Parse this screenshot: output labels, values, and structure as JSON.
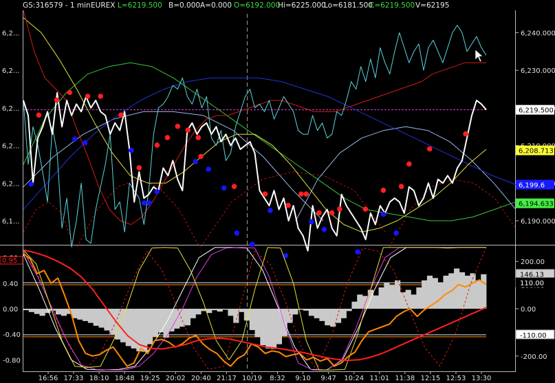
{
  "header": {
    "symbol": "GS:316579 - 1 min",
    "exchange": "EUREX",
    "last": "L=6219.500",
    "bid": "B=0.000",
    "ask": "A=0.000",
    "open": "O=6192.000",
    "high": "Hi=6225.000",
    "low": "Lo=6181.500",
    "close": "C=6219.500",
    "volume": "V=62195"
  },
  "colors": {
    "background": "#000000",
    "axis": "#cfcfcf",
    "price": "#ffffff",
    "cyan": "#59d6dc",
    "red": "#d41c14",
    "green": "#3cc43c",
    "blue": "#2035d8",
    "lightblue": "#9ab8e8",
    "yellow": "#e6e23a",
    "orange": "#ff8a00",
    "magenta": "#e040e0",
    "gray_fill": "#c9c9c9",
    "dot_red": "#ff2020",
    "dot_blue": "#1414ff"
  },
  "chart_data": [
    {
      "type": "line",
      "panel": "price",
      "ylim": [
        6183.6,
        6245.4
      ],
      "y_ticks": [
        6190.0,
        6200.0,
        6210.0,
        6220.0,
        6230.0,
        6240.0
      ],
      "y_tick_labels": [
        "6,190.000",
        "6,200.000",
        "6,210.000",
        "6,220.000",
        "6,230.000",
        "6,240.000"
      ],
      "left_tick_labels": [
        "6,2...",
        "6,2...",
        "6,2...",
        "6,2...",
        "6,2...",
        "6,1..."
      ],
      "left_tick_values": [
        6240,
        6230,
        6220,
        6210,
        6200,
        6190
      ],
      "price_labels": [
        {
          "text": "6,219.500",
          "value": 6219.5,
          "bg": "#ffffff",
          "fg": "#000000"
        },
        {
          "text": "6,208.713",
          "value": 6208.713,
          "bg": "#ffff33",
          "fg": "#000000"
        },
        {
          "text": "6,199.6",
          "value": 6199.6,
          "bg": "#1a1aff",
          "fg": "#ffffff"
        },
        {
          "text": "6,194.633",
          "value": 6194.633,
          "bg": "#44ee44",
          "fg": "#000000"
        }
      ],
      "reference_line": 6219.5,
      "x_ticks": [
        "16:56",
        "17:33",
        "18:10",
        "18:48",
        "19:25",
        "20:02",
        "20:40",
        "21:17",
        "10/19",
        "8:32",
        "9:10",
        "9:47",
        "10:24",
        "11:01",
        "11:38",
        "12:15",
        "12:53",
        "13:30"
      ],
      "series": [
        {
          "role": "price",
          "color": "#ffffff",
          "values": [
            6222,
            6218,
            6200,
            6212,
            6215,
            6219,
            6213,
            6224,
            6215,
            6222,
            6218,
            6221,
            6219,
            6223,
            6220,
            6222,
            6219,
            6218,
            6213,
            6216,
            6214,
            6219,
            6209,
            6195,
            6203,
            6196,
            6197,
            6199,
            6198,
            6204,
            6202,
            6206,
            6201,
            6198,
            6214,
            6216,
            6213,
            6215,
            6216,
            6213,
            6215,
            6211,
            6213,
            6210,
            6212,
            6209,
            6210,
            6211,
            6208,
            6198,
            6196,
            6194,
            6198,
            6193,
            6196,
            6190,
            6194,
            6188,
            6186,
            6182,
            6194,
            6188,
            6191,
            6193,
            6188,
            6186,
            6197,
            6194,
            6192,
            6190,
            6188,
            6185,
            6192,
            6189,
            6194,
            6192,
            6195,
            6196,
            6195,
            6192,
            6199,
            6198,
            6194,
            6196,
            6200,
            6196,
            6201,
            6200,
            6202,
            6200,
            6204,
            6206,
            6212,
            6218,
            6222,
            6221,
            6219.5
          ]
        },
        {
          "role": "cyan overlay",
          "color": "#59d6dc",
          "values": [
            6222,
            6205,
            6215,
            6210,
            6203,
            6195,
            6215,
            6208,
            6188,
            6196,
            6183,
            6190,
            6200,
            6185,
            6184,
            6193,
            6199,
            6205,
            6213,
            6193,
            6195,
            6187,
            6200,
            6198,
            6196,
            6189,
            6198,
            6213,
            6220,
            6221,
            6223,
            6226,
            6225,
            6228,
            6223,
            6221,
            6225,
            6220,
            6223,
            6212,
            6210,
            6214,
            6206,
            6208,
            6215,
            6219,
            6223,
            6225,
            6220,
            6221,
            6219,
            6222,
            6217,
            6220,
            6223,
            6221,
            6219,
            6214,
            6213,
            6213,
            6218,
            6214,
            6216,
            6212,
            6213,
            6219,
            6218,
            6222,
            6227,
            6225,
            6231,
            6227,
            6233,
            6228,
            6236,
            6232,
            6229,
            6235,
            6240,
            6236,
            6232,
            6235,
            6237,
            6230,
            6236,
            6238,
            6235,
            6232,
            6236,
            6240,
            6242,
            6240,
            6235,
            6237,
            6239,
            6236,
            6234
          ]
        },
        {
          "role": "red curve",
          "color": "#d41c14",
          "values": [
            6246,
            6235,
            6228,
            6225,
            6222,
            6214,
            6207,
            6199,
            6193,
            6190,
            6189,
            6191,
            6195,
            6200,
            6205,
            6210,
            6214,
            6217,
            6218,
            6218,
            6219,
            6220,
            6221,
            6222,
            6222,
            6221,
            6220,
            6219,
            6219,
            6219,
            6220,
            6221,
            6222,
            6223,
            6224,
            6225,
            6226,
            6227,
            6229,
            6230,
            6231,
            6232,
            6232,
            6232
          ]
        },
        {
          "role": "green curve",
          "color": "#3cc43c",
          "values": [
            6205,
            6217,
            6224,
            6229,
            6231,
            6232,
            6231,
            6228,
            6224,
            6220,
            6216,
            6212,
            6208,
            6204,
            6200,
            6196,
            6193,
            6192,
            6191,
            6190,
            6190,
            6191,
            6193,
            6195
          ]
        },
        {
          "role": "blue curve",
          "color": "#2035d8",
          "values": [
            6193,
            6200,
            6207,
            6213,
            6218,
            6222,
            6225,
            6227,
            6228,
            6228,
            6228,
            6227,
            6225,
            6223,
            6220,
            6217,
            6214,
            6211,
            6208,
            6205,
            6202,
            6199.6
          ]
        },
        {
          "role": "light blue arc 1",
          "color": "#9ab8e8",
          "values": [
            6199,
            6207,
            6213,
            6217,
            6219,
            6219,
            6218,
            6214,
            6207,
            6198,
            6190
          ]
        },
        {
          "role": "light blue arc 2",
          "color": "#9ab8e8",
          "values": [
            6190,
            6201,
            6208,
            6212,
            6214,
            6215,
            6214,
            6211,
            6206,
            6200,
            6193
          ]
        },
        {
          "role": "yellow curve",
          "color": "#e6e23a",
          "values": [
            6244,
            6240,
            6233,
            6225,
            6216,
            6208,
            6202,
            6200,
            6200,
            6203,
            6207,
            6211,
            6213,
            6213,
            6210,
            6205,
            6199,
            6193,
            6189,
            6187,
            6188,
            6190,
            6193,
            6196,
            6200,
            6205,
            6209
          ]
        },
        {
          "role": "dashed red arcs",
          "color": "#b81410",
          "style": "dashed",
          "segments": [
            [
              6187,
              6193,
              6195,
              6192,
              6183
            ],
            [
              6183,
              6193,
              6199,
              6201,
              6199,
              6193,
              6183
            ],
            [
              6183,
              6195,
              6201,
              6203,
              6202,
              6198,
              6187
            ],
            [
              6183,
              6193,
              6199,
              6201,
              6200,
              6196,
              6188
            ]
          ]
        },
        {
          "role": "red markers (highs)",
          "color": "#ff2020",
          "marker": "dot",
          "x": [
            0.06,
            0.13,
            0.18,
            0.25,
            0.3,
            0.38,
            0.45,
            0.52,
            0.56,
            0.6,
            0.64,
            0.68,
            0.69,
            0.82,
            0.94,
            1.03,
            1.08,
            1.1,
            1.15,
            1.2,
            1.23,
            1.33,
            1.4,
            1.47,
            1.5,
            1.58,
            1.72
          ],
          "values": [
            6217,
            6221,
            6223,
            6222,
            6222,
            6217,
            6203,
            6209,
            6211,
            6214,
            6213,
            6211,
            6206,
            6198,
            6196,
            6193,
            6196,
            6196,
            6191,
            6191,
            6192,
            6192,
            6197,
            6198,
            6204,
            6208,
            6212
          ]
        },
        {
          "role": "blue markers (lows)",
          "color": "#1414ff",
          "marker": "dot",
          "x": [
            0.03,
            0.2,
            0.24,
            0.42,
            0.47,
            0.49,
            0.52,
            0.67,
            0.72,
            0.78,
            0.83,
            0.89,
            0.96,
            1.02,
            1.12,
            1.17,
            1.3,
            1.4,
            1.45
          ],
          "values": [
            6201,
            6213,
            6212,
            6210,
            6196,
            6196,
            6199,
            6207,
            6205,
            6200,
            6188,
            6185,
            6194,
            6182,
            6191,
            6189,
            6183,
            6193,
            6188
          ]
        }
      ]
    },
    {
      "type": "area",
      "panel": "indicator",
      "ylim": [
        -0.98,
        0.98
      ],
      "left_ticks": [
        0.8,
        0.4,
        0.0,
        -0.4,
        -0.8
      ],
      "left_tick_labels": [
        "0.80",
        "0.40",
        "0.00",
        "-0.40",
        "-0.80"
      ],
      "left_marker": "0.95",
      "right_ticks": [
        200,
        100,
        0,
        -100,
        -200
      ],
      "right_tick_labels": [
        "200.00",
        "100.00",
        "0.00",
        "-100.00",
        "-200.00"
      ],
      "right_labels": [
        {
          "text": "146.13",
          "value": 146.13,
          "bg": "#cfcfcf",
          "fg": "#000000"
        },
        {
          "text": "110.00",
          "value": 110,
          "bg": "#000000",
          "fg": "#ffffff"
        },
        {
          "text": "-110.00",
          "value": -110,
          "bg": "#ffffff",
          "fg": "#000000"
        }
      ],
      "hlines_right_units": [
        110,
        -110
      ],
      "series": [
        {
          "role": "gray histogram",
          "color": "#c9c9c9",
          "values": [
            -6,
            -14,
            -22,
            -30,
            -18,
            -8,
            -24,
            -30,
            -22,
            -40,
            -46,
            -52,
            -60,
            -72,
            -80,
            -92,
            -108,
            -130,
            -142,
            -158,
            -168,
            -180,
            -182,
            -150,
            -118,
            -100,
            -122,
            -96,
            -84,
            -76,
            -70,
            -40,
            -24,
            -10,
            -18,
            -6,
            -12,
            -4,
            -30,
            -60,
            -14,
            -50,
            -90,
            -120,
            -154,
            -168,
            -170,
            -150,
            -116,
            -60,
            -24,
            -4,
            -8,
            -30,
            -40,
            -52,
            -70,
            -76,
            -60,
            -40,
            -10,
            30,
            60,
            54,
            80,
            56,
            90,
            110,
            100,
            120,
            70,
            80,
            60,
            90,
            120,
            140,
            130,
            110,
            140,
            150,
            170,
            154,
            140,
            150,
            120,
            146
          ]
        },
        {
          "role": "orange oscillator",
          "color": "#ff8a00",
          "values": [
            0.86,
            0.78,
            0.55,
            0.6,
            0.4,
            0.48,
            0.2,
            -0.1,
            -0.5,
            -0.7,
            -0.74,
            -0.72,
            -0.65,
            -0.6,
            -0.75,
            -0.9,
            -0.85,
            -0.62,
            -0.7,
            -0.5,
            -0.48,
            -0.52,
            -0.6,
            -0.55,
            -0.46,
            -0.42,
            -0.55,
            -0.64,
            -0.7,
            -0.82,
            -0.9,
            -0.78,
            -0.72,
            -0.55,
            -0.6,
            -0.7,
            -0.66,
            -0.68,
            -0.75,
            -0.72,
            -0.7,
            -0.8,
            -0.76,
            -0.82,
            -0.78,
            -0.9,
            -0.85,
            -0.75,
            -0.68,
            -0.5,
            -0.36,
            -0.32,
            -0.28,
            -0.24,
            -0.12,
            -0.05,
            0.0,
            -0.12,
            -0.02,
            0.05,
            0.12,
            0.22,
            0.28,
            0.38,
            0.34,
            0.4,
            0.45,
            0.38
          ]
        },
        {
          "role": "red oscillator",
          "color": "#ff2020",
          "values": [
            0.92,
            0.88,
            0.82,
            0.74,
            0.64,
            0.5,
            0.3,
            0.05,
            -0.2,
            -0.42,
            -0.56,
            -0.62,
            -0.63,
            -0.6,
            -0.56,
            -0.5,
            -0.47,
            -0.46,
            -0.48,
            -0.52,
            -0.56,
            -0.6,
            -0.62,
            -0.65,
            -0.68,
            -0.72,
            -0.76,
            -0.79,
            -0.81,
            -0.8,
            -0.76,
            -0.7,
            -0.62,
            -0.54,
            -0.46,
            -0.38,
            -0.3,
            -0.22,
            -0.14,
            -0.06,
            0.02
          ]
        },
        {
          "role": "yellow oscillator",
          "color": "#e6e23a",
          "values": [
            0.92,
            0.7,
            0.1,
            -0.5,
            -0.9,
            -0.92,
            -0.9,
            -0.5,
            0.0,
            0.6,
            0.95,
            0.96,
            0.95,
            0.6,
            0.1,
            -0.5,
            -0.8,
            -0.5,
            0.3,
            0.96,
            0.95,
            0.4,
            -0.5,
            -0.96,
            -0.96,
            -0.95,
            -0.4,
            0.3,
            0.96,
            0.96,
            0.96,
            0.96,
            0.96,
            0.95,
            0.96,
            0.96,
            0.96
          ]
        },
        {
          "role": "magenta oscillator",
          "color": "#e040e0",
          "values": [
            0.9,
            0.5,
            0.0,
            -0.5,
            -0.88,
            -0.95,
            -0.96,
            -0.96,
            -0.9,
            -0.7,
            -0.4,
            0.0,
            0.5,
            0.85,
            0.95,
            0.96,
            0.95,
            0.5,
            -0.2,
            -0.85,
            -0.96,
            -0.96,
            -0.8,
            -0.3,
            0.3,
            0.8,
            0.96,
            0.96,
            0.96,
            0.96,
            0.96,
            0.96,
            0.96
          ]
        },
        {
          "role": "white oscillator",
          "color": "#ffffff",
          "values": [
            0.85,
            0.3,
            -0.3,
            -0.8,
            -0.95,
            -0.96,
            -0.95,
            -0.9,
            -0.6,
            -0.2,
            0.3,
            0.8,
            0.96,
            0.96,
            0.95,
            0.6,
            0.0,
            -0.6,
            -0.95,
            -0.96,
            -0.8,
            -0.3,
            0.3,
            0.8,
            0.96,
            0.96,
            0.96,
            0.96,
            0.96,
            0.96
          ]
        },
        {
          "role": "dashed red oscillator",
          "color": "#d41c14",
          "style": "dashed",
          "values": [
            0.9,
            0.5,
            -0.1,
            -0.6,
            -0.95,
            -0.7,
            -0.2,
            0.4,
            0.9,
            0.6,
            0.0,
            -0.6,
            -0.95,
            -0.9,
            0.0,
            0.9,
            0.7,
            0.1,
            -0.6,
            -0.95,
            -0.4,
            0.4,
            0.95,
            0.9,
            0.6,
            0.0,
            -0.6,
            -0.9,
            -0.4,
            0.4,
            0.96
          ]
        }
      ]
    }
  ]
}
